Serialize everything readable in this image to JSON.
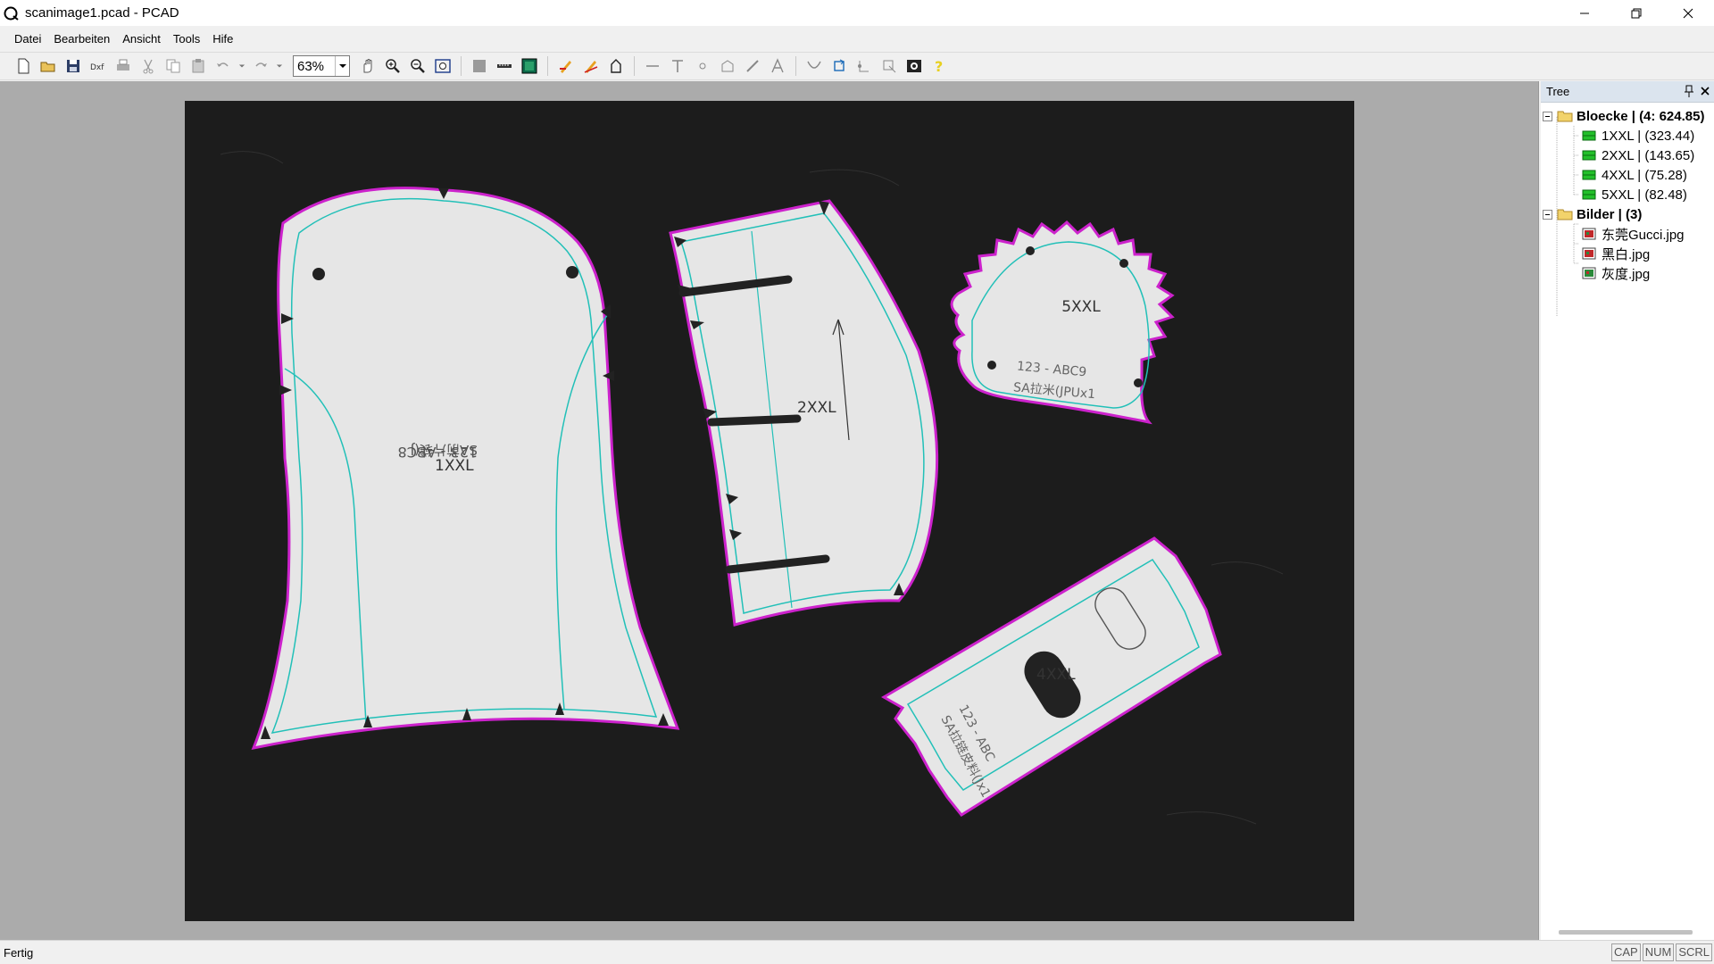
{
  "window": {
    "title": "scanimage1.pcad - PCAD"
  },
  "menu": {
    "items": [
      "Datei",
      "Bearbeiten",
      "Ansicht",
      "Tools",
      "Hife"
    ]
  },
  "toolbar": {
    "zoom": "63%"
  },
  "canvas": {
    "pieces": [
      {
        "label": "1XXL",
        "text": "123 - ABC8",
        "subtext": "SA前片袋(J"
      },
      {
        "label": "2XXL"
      },
      {
        "label": "5XXL",
        "text": "123 - ABC9",
        "subtext": "SA拉米(JPUx1"
      },
      {
        "label": "4XXL",
        "text": "123 - ABC",
        "subtext": "SA拉链皮料(Jx1"
      }
    ],
    "colors": {
      "background": "#1c1c1c",
      "piece": "#e6e6e6",
      "outline": "#cc22cc",
      "seam": "#22c0b8"
    }
  },
  "tree": {
    "title": "Tree",
    "groups": [
      {
        "label": "Bloecke | (4: 624.85)",
        "icon": "folder-icon",
        "children": [
          {
            "label": "1XXL | (323.44)",
            "icon": "block-icon"
          },
          {
            "label": "2XXL | (143.65)",
            "icon": "block-icon"
          },
          {
            "label": "4XXL | (75.28)",
            "icon": "block-icon"
          },
          {
            "label": "5XXL | (82.48)",
            "icon": "block-icon"
          }
        ]
      },
      {
        "label": "Bilder | (3)",
        "icon": "folder-icon",
        "children": [
          {
            "label": "东莞Gucci.jpg",
            "icon": "image-icon"
          },
          {
            "label": "黑白.jpg",
            "icon": "image-icon"
          },
          {
            "label": "灰度.jpg",
            "icon": "image-icon"
          }
        ]
      }
    ]
  },
  "status": {
    "text": "Fertig",
    "indicators": [
      "CAP",
      "NUM",
      "SCRL"
    ]
  }
}
